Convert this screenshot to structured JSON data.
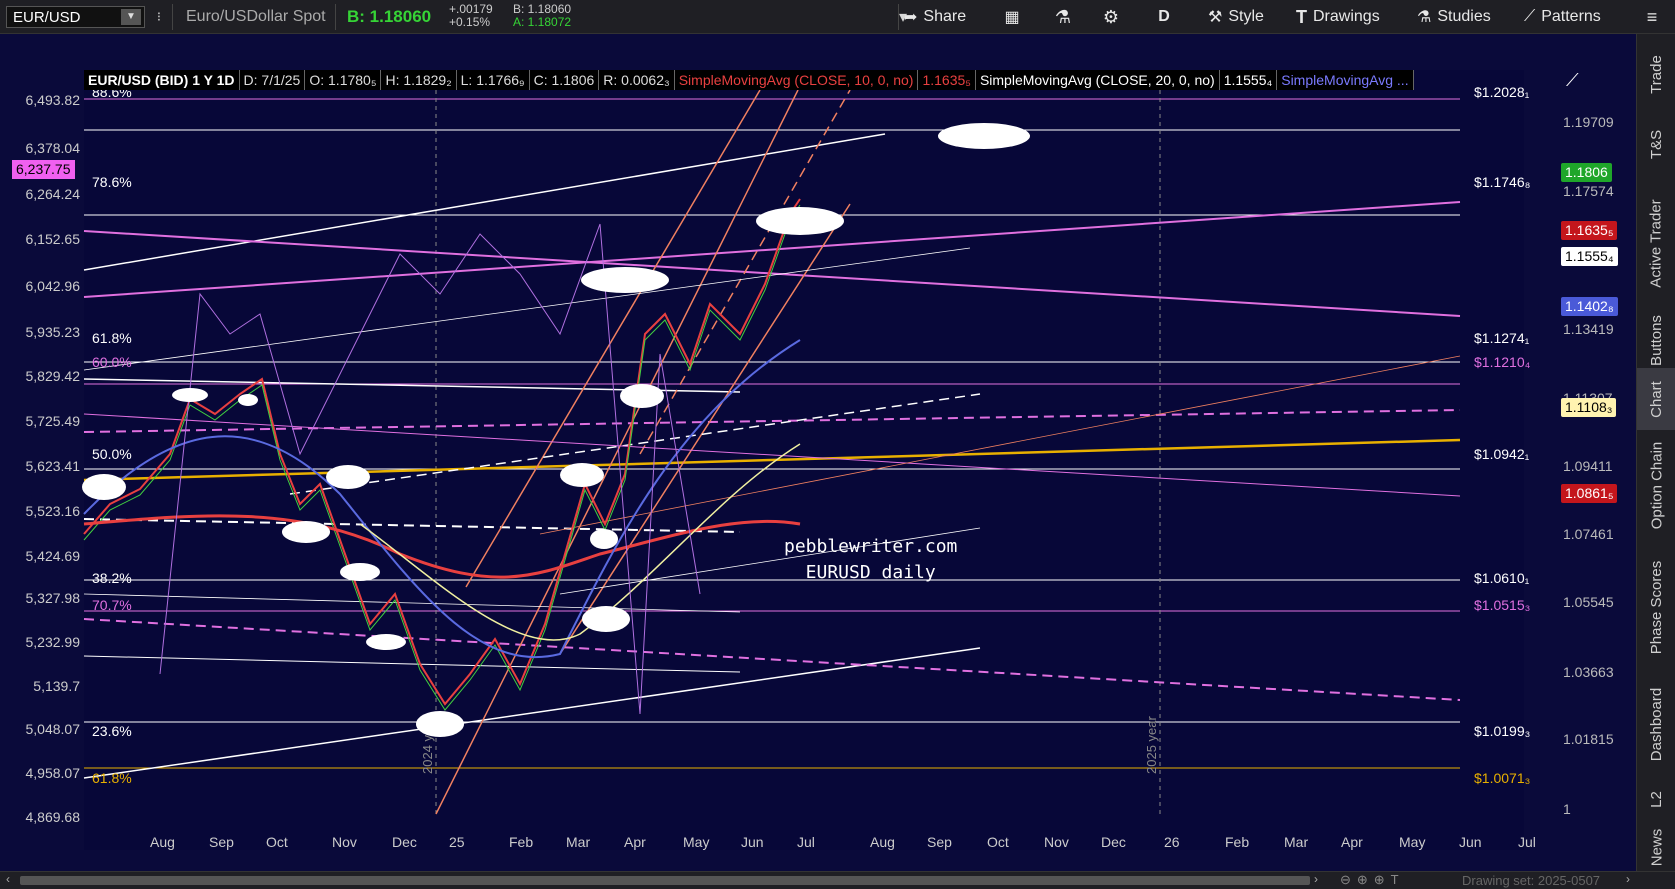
{
  "toolbar": {
    "symbol": "EUR/USD",
    "description": "Euro/USDollar Spot",
    "bid": "B: 1.18060",
    "change": "+.00179",
    "change_pct": "+0.15%",
    "quote_b": "B: 1.18060",
    "quote_a": "A: 1.18072",
    "share": "Share",
    "period": "D",
    "style": "Style",
    "drawings": "Drawings",
    "studies": "Studies",
    "patterns": "Patterns"
  },
  "legend": {
    "name": "EUR/USD (BID) 1 Y 1D",
    "date": "D: 7/1/25",
    "open": "O: 1.1780₅",
    "high": "H: 1.1829₂",
    "low": "L: 1.1766₉",
    "close": "C: 1.1806",
    "range": "R: 0.0062₃",
    "sma10": "SimpleMovingAvg (CLOSE, 10, 0, no)",
    "sma10_val": "1.1635₅",
    "sma20": "SimpleMovingAvg (CLOSE, 20, 0, no)",
    "sma20_val": "1.1555₄",
    "sma_more": "SimpleMovingAvg ..."
  },
  "left_axis": [
    "6,493.82",
    "6,378.04",
    "6,264.24",
    "6,152.65",
    "6,042.96",
    "5,935.23",
    "5,829.42",
    "5,725.49",
    "5,623.41",
    "5,523.16",
    "5,424.69",
    "5,327.98",
    "5,232.99",
    "5,139.7",
    "5,048.07",
    "4,958.07",
    "4,869.68"
  ],
  "left_badge": "6,237.75",
  "right_axis": [
    "1.19709",
    "1.17574",
    "1.13419",
    "1.11307",
    "1.09411",
    "1.07461",
    "1.05545",
    "1.03663",
    "1.01815",
    "1"
  ],
  "right_badges": [
    {
      "text": "1.1806",
      "bg": "#1fa62a",
      "fg": "#ffffff"
    },
    {
      "text": "1.1635₅",
      "bg": "#c4161c",
      "fg": "#ffffff"
    },
    {
      "text": "1.1555₄",
      "bg": "#ffffff",
      "fg": "#000000"
    },
    {
      "text": "1.1402₈",
      "bg": "#4a5ad8",
      "fg": "#ffffff"
    },
    {
      "text": "1.1108₃",
      "bg": "#fff3b0",
      "fg": "#000000"
    },
    {
      "text": "1.0861₅",
      "bg": "#c4161c",
      "fg": "#ffffff"
    }
  ],
  "fib_levels": [
    {
      "pct": "88.6%",
      "price": "$1.2028₁",
      "color": "#ffffff"
    },
    {
      "pct": "78.6%",
      "price": "$1.1746₈",
      "color": "#ffffff"
    },
    {
      "pct": "61.8%",
      "price": "$1.1274₁",
      "color": "#ffffff"
    },
    {
      "pct": "60.0%",
      "price": "$1.1210₄",
      "color": "#e070e0"
    },
    {
      "pct": "50.0%",
      "price": "$1.0942₁",
      "color": "#ffffff"
    },
    {
      "pct": "38.2%",
      "price": "$1.0610₁",
      "color": "#ffffff"
    },
    {
      "pct": "70.7%",
      "price": "$1.0515₃",
      "color": "#e070e0"
    },
    {
      "pct": "23.6%",
      "price": "$1.0199₃",
      "color": "#ffffff"
    },
    {
      "pct": "61.8%",
      "price": "$1.0071₃",
      "color": "#e8b000"
    }
  ],
  "x_axis": [
    "Aug",
    "Sep",
    "Oct",
    "Nov",
    "Dec",
    "25",
    "Feb",
    "Mar",
    "Apr",
    "May",
    "Jun",
    "Jul",
    "Aug",
    "Sep",
    "Oct",
    "Nov",
    "Dec",
    "26",
    "Feb",
    "Mar",
    "Apr",
    "May",
    "Jun",
    "Jul"
  ],
  "year_markers": [
    "2024 year",
    "2025 year"
  ],
  "watermark": [
    "pebblewriter.com",
    "EURUSD daily"
  ],
  "sidebar_tabs": [
    "Trade",
    "T&S",
    "Active Trader",
    "Buttons",
    "Chart",
    "Option Chain",
    "Phase Scores",
    "Dashboard",
    "L2",
    "News"
  ],
  "active_tab": "Chart",
  "bottom": {
    "drawing_set": "Drawing set: 2025-0507"
  },
  "colors": {
    "bg": "#070738",
    "white_line": "#ffffff",
    "magenta": "#e070e0",
    "orange": "#f08060",
    "gold": "#e8b000",
    "blue": "#5a6ae0",
    "red": "#e04040",
    "yellow": "#f0f0a0"
  }
}
